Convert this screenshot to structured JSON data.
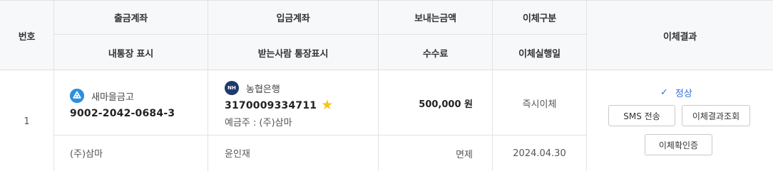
{
  "header": {
    "no": "번호",
    "from_account": "출금계좌",
    "my_passbook_display": "내통장 표시",
    "to_account": "입금계좌",
    "recipient_passbook_display": "받는사람 통장표시",
    "amount": "보내는금액",
    "fee": "수수료",
    "transfer_type": "이체구분",
    "execution_date": "이체실행일",
    "result": "이체결과"
  },
  "row": {
    "no": "1",
    "from_bank": "새마을금고",
    "from_bank_icon": "mg-bank-logo-icon",
    "from_account_number": "9002-2042-0684-3",
    "my_display": "(주)삼마",
    "to_bank": "농협은행",
    "to_bank_icon": "nh-bank-logo-icon",
    "to_bank_badge": "NH",
    "to_account_number": "3170009334711",
    "favorite_icon": "star-icon",
    "depositor": "예금주 : (주)삼마",
    "recipient_display": "윤인재",
    "amount": "500,000 원",
    "fee": "면제",
    "transfer_type": "즉시이체",
    "execution_date": "2024.04.30",
    "status": "정상",
    "status_icon": "check-icon",
    "status_color": "#2f6fdb",
    "buttons": {
      "sms": "SMS 전송",
      "result_lookup": "이체결과조회",
      "confirmation": "이체확인증"
    }
  }
}
